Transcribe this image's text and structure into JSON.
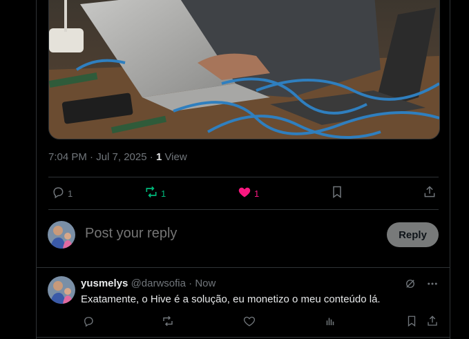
{
  "post": {
    "timestamp": "7:04 PM · Jul 7, 2025",
    "sep": " · ",
    "views_count": "1",
    "views_label": "View",
    "actions": {
      "replies": "1",
      "reposts": "1",
      "likes": "1"
    },
    "colors": {
      "repost": "#00ba7c",
      "like": "#f91880"
    }
  },
  "reply_composer": {
    "placeholder": "Post your reply",
    "button_label": "Reply"
  },
  "reply": {
    "name": "yusmelys",
    "handle": "@darwsofia",
    "dot": " · ",
    "time": "Now",
    "text": "Exatamente, o Hive é a solução, eu monetizo o meu conteúdo lá."
  }
}
